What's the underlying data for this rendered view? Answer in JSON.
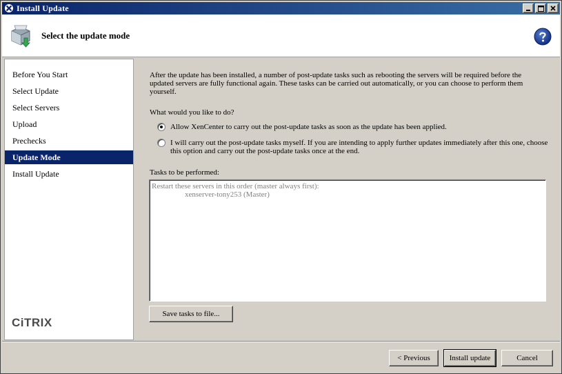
{
  "window": {
    "title": "Install Update"
  },
  "header": {
    "title": "Select the update mode",
    "icon": "package-install-icon",
    "help_icon": "help-question-icon"
  },
  "sidebar": {
    "items": [
      {
        "label": "Before You Start",
        "active": false
      },
      {
        "label": "Select Update",
        "active": false
      },
      {
        "label": "Select Servers",
        "active": false
      },
      {
        "label": "Upload",
        "active": false
      },
      {
        "label": "Prechecks",
        "active": false
      },
      {
        "label": "Update Mode",
        "active": true
      },
      {
        "label": "Install Update",
        "active": false
      }
    ],
    "logo": "CiTRIX"
  },
  "main": {
    "intro": "After the update has been installed, a number of post-update tasks such as rebooting the servers will be required before the updated servers are fully functional again. These tasks can be carried out automatically, or you can choose to perform them yourself.",
    "question": "What would you like to do?",
    "options": [
      {
        "label": "Allow XenCenter to carry out the post-update tasks as soon as the update has been applied.",
        "checked": true
      },
      {
        "label": "I will carry out the post-update tasks myself. If you are intending to apply further updates immediately after this one, choose this option and carry out the post-update tasks once at the end.",
        "checked": false
      }
    ],
    "tasks_label": "Tasks to be performed:",
    "tasks_lines": [
      "Restart these servers in this order (master always first):",
      "xenserver-tony253 (Master)"
    ],
    "save_button": "Save tasks to file..."
  },
  "footer": {
    "previous": "< Previous",
    "install": "Install update",
    "cancel": "Cancel"
  },
  "colors": {
    "titlebar": "#0a246a",
    "selection": "#0a246a",
    "dialog_bg": "#d4d0c8"
  }
}
